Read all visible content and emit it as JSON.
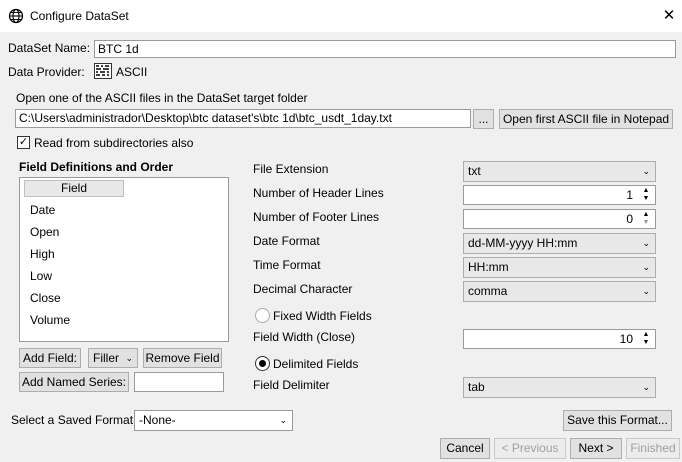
{
  "window": {
    "title": "Configure DataSet",
    "close_glyph": "✕"
  },
  "dataset": {
    "name_label": "DataSet Name:",
    "name_value": "BTC 1d",
    "provider_label": "Data Provider:",
    "provider_value": "ASCII"
  },
  "file": {
    "instruction": "Open one of the ASCII files in the DataSet target folder",
    "path": "C:\\Users\\administrador\\Desktop\\btc dataset's\\btc 1d\\btc_usdt_1day.txt",
    "browse_label": "...",
    "open_notepad_label": "Open first ASCII file in Notepad",
    "subdirs_label": "Read from subdirectories also",
    "subdirs_checked": true
  },
  "fields": {
    "heading": "Field Definitions and Order",
    "column_header": "Field",
    "items": [
      "Date",
      "Open",
      "High",
      "Low",
      "Close",
      "Volume"
    ],
    "add_field_label": "Add Field:",
    "filler_label": "Filler",
    "remove_field_label": "Remove Field",
    "add_named_series_label": "Add Named Series:",
    "named_series_value": ""
  },
  "settings": {
    "file_extension_label": "File Extension",
    "file_extension_value": "txt",
    "header_lines_label": "Number of Header Lines",
    "header_lines_value": "1",
    "footer_lines_label": "Number of Footer Lines",
    "footer_lines_value": "0",
    "date_format_label": "Date Format",
    "date_format_value": "dd-MM-yyyy HH:mm",
    "time_format_label": "Time Format",
    "time_format_value": "HH:mm",
    "decimal_label": "Decimal Character",
    "decimal_value": "comma",
    "fixed_width_label": "Fixed Width Fields",
    "fixed_width_selected": false,
    "field_width_label": "Field Width (Close)",
    "field_width_value": "10",
    "delimited_label": "Delimited Fields",
    "delimited_selected": true,
    "delimiter_label": "Field Delimiter",
    "delimiter_value": "tab"
  },
  "footer": {
    "saved_format_label": "Select a Saved Format",
    "saved_format_value": "-None-",
    "save_format_label": "Save this Format...",
    "cancel_label": "Cancel",
    "previous_label": "< Previous",
    "next_label": "Next >",
    "finished_label": "Finished"
  },
  "icons": {
    "app": "globe-icon",
    "provider": "ascii-grid-icon",
    "dropdown": "chevron-down-icon",
    "spin_up": "spin-up-icon",
    "spin_down": "spin-down-icon",
    "check": "checkmark-icon"
  }
}
